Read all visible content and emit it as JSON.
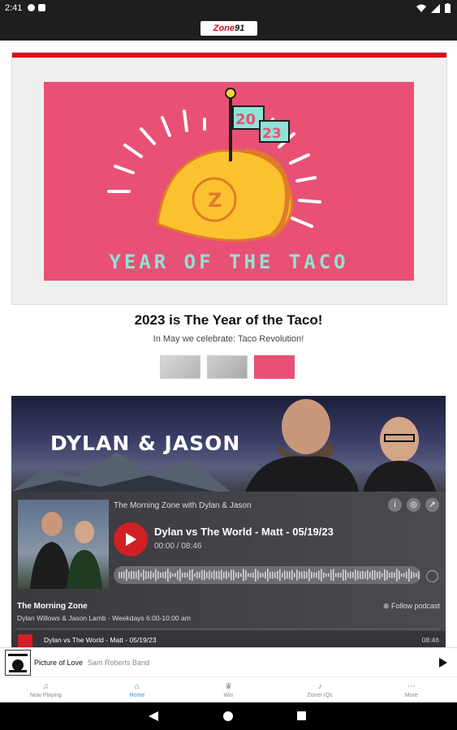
{
  "statusbar": {
    "time": "2:41"
  },
  "app": {
    "logo_text_a": "Zone",
    "logo_text_b": "91"
  },
  "hero": {
    "image_text": "YEAR OF THE TACO",
    "flag_top": "20",
    "flag_bottom": "23",
    "headline": "2023 is The Year of the Taco!",
    "subheadline": "In May we celebrate: Taco Revolution!"
  },
  "podcast": {
    "banner_title": "DYLAN & JASON",
    "show_name": "The Morning Zone with Dylan & Jason",
    "episode_title": "Dylan vs The World - Matt - 05/19/23",
    "episode_time": "00:00 / 08:46",
    "program_name": "The Morning Zone",
    "program_sub": "Dylan Willows & Jason Lamb · Weekdays 6:00-10:00 am",
    "follow_label": "Follow podcast",
    "list_episode_title": "Dylan vs The World - Matt - 05/19/23",
    "list_episode_duration": "08:46"
  },
  "now_playing": {
    "song": "Picture of Love",
    "artist": "Sam Roberts Band"
  },
  "bottom_nav": [
    {
      "label": "Now Playing",
      "icon": "music-note-icon"
    },
    {
      "label": "Home",
      "icon": "home-icon"
    },
    {
      "label": "Win",
      "icon": "trophy-icon"
    },
    {
      "label": "Zoner IQs",
      "icon": "mic-icon"
    },
    {
      "label": "More",
      "icon": "more-icon"
    }
  ],
  "colors": {
    "accent": "#3b8ef0",
    "brand_red": "#d3141a",
    "taco_pink": "#e95075",
    "taco_teal": "#8fe3d6"
  }
}
